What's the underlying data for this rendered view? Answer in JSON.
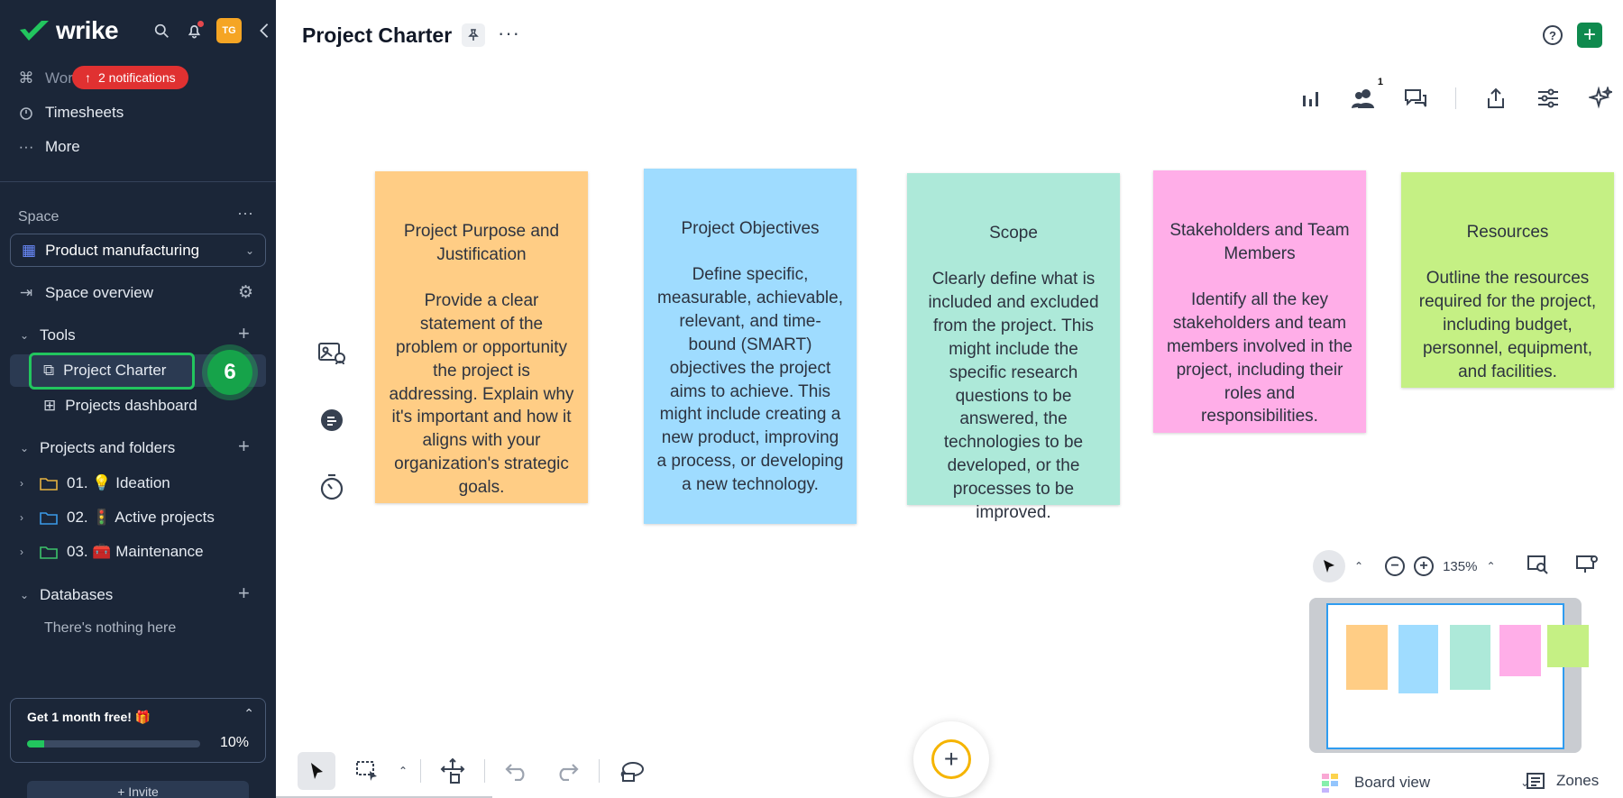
{
  "sidebar": {
    "brand": "wrike",
    "avatar_initials": "TG",
    "notification_pill": "2 notifications",
    "nav": [
      {
        "label": "Work",
        "icon": "work-icon"
      },
      {
        "label": "Timesheets",
        "icon": "clock-icon"
      },
      {
        "label": "More",
        "icon": "dots-icon"
      }
    ],
    "space_label": "Space",
    "space_selected": "Product manufacturing",
    "space_overview": "Space overview",
    "tools_label": "Tools",
    "tools_items": [
      "Project Charter",
      "Projects dashboard"
    ],
    "step_number": "6",
    "projects_label": "Projects and folders",
    "folders": [
      {
        "label": "01. 💡 Ideation",
        "color": "#e8b341"
      },
      {
        "label": "02. 🚦 Active projects",
        "color": "#3b9ae8"
      },
      {
        "label": "03. 🧰 Maintenance",
        "color": "#3cc36a"
      }
    ],
    "databases_label": "Databases",
    "databases_empty": "There's nothing here",
    "promo_title": "Get 1 month free! 🎁",
    "promo_progress": 10,
    "promo_pct": "10%",
    "invite_label": "+ Invite"
  },
  "main": {
    "title": "Project Charter",
    "toolbar_badge": "1",
    "zoom": "135%",
    "board_view": "Board view",
    "zones": "Zones"
  },
  "notes": [
    {
      "title": "Project Purpose and Justification",
      "body": "Provide a clear statement of the problem or opportunity the project is addressing. Explain why it's important and how it aligns with your organization's strategic goals.",
      "color": "#ffcd85"
    },
    {
      "title": "Project Objectives",
      "body": "Define specific, measurable, achievable, relevant, and time-bound (SMART) objectives the project aims to achieve. This might include creating a new product, improving a process, or developing a new technology.",
      "color": "#9fdcff"
    },
    {
      "title": "Scope",
      "body": "Clearly define what is included and excluded from the project. This might include the specific research questions to be answered, the technologies to be developed, or the processes to be improved.",
      "color": "#ade9d9"
    },
    {
      "title": "Stakeholders and Team Members",
      "body": "Identify all the key stakeholders and team members involved in the project, including their roles and responsibilities.",
      "color": "#ffaee8"
    },
    {
      "title": "Resources",
      "body": "Outline the resources required for the project, including budget, personnel, equipment, and facilities.",
      "color": "#c5f084"
    }
  ],
  "colors": {
    "sidebar_bg": "#1b2638",
    "accent_green": "#22c55e",
    "brand_green": "#0f8a4e",
    "notif_red": "#e03131"
  }
}
